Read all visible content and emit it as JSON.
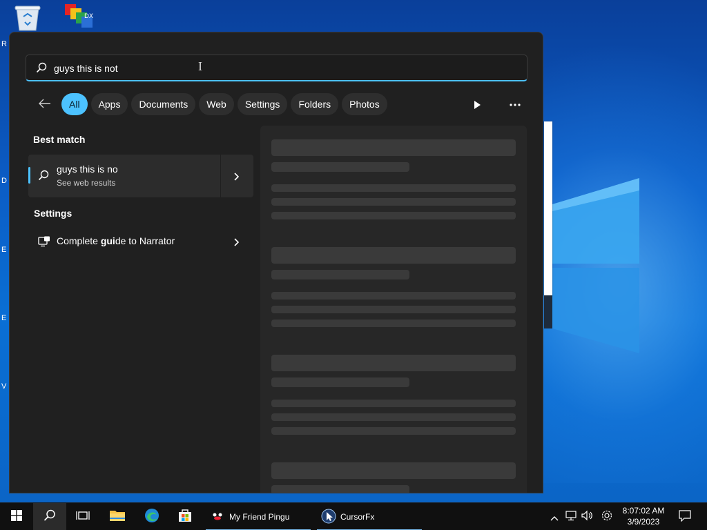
{
  "search": {
    "query": "guys this is not"
  },
  "filters": [
    {
      "label": "All",
      "active": true
    },
    {
      "label": "Apps"
    },
    {
      "label": "Documents"
    },
    {
      "label": "Web"
    },
    {
      "label": "Settings"
    },
    {
      "label": "Folders"
    },
    {
      "label": "Photos"
    }
  ],
  "results": {
    "best_match_heading": "Best match",
    "best_match": {
      "title": "guys this is no",
      "subtitle": "See web results",
      "icon": "search-icon"
    },
    "settings_heading": "Settings",
    "settings_item": {
      "label_before": "Complete ",
      "label_bold": "gui",
      "label_after": "de to Narrator",
      "icon": "narrator-icon"
    }
  },
  "desktop": {
    "edge_letters": [
      "R",
      "D",
      "E",
      "E",
      "V"
    ]
  },
  "taskbar": {
    "apps": [
      {
        "label": "My Friend Pingu",
        "icon": "pingu-icon"
      },
      {
        "label": "CursorFx",
        "icon": "cursorfx-icon"
      }
    ],
    "clock": {
      "time": "8:07:02 AM",
      "date": "3/9/2023"
    }
  },
  "colors": {
    "accent": "#4cc2ff",
    "panel_bg": "#202020",
    "taskbar_bg": "#101010"
  }
}
